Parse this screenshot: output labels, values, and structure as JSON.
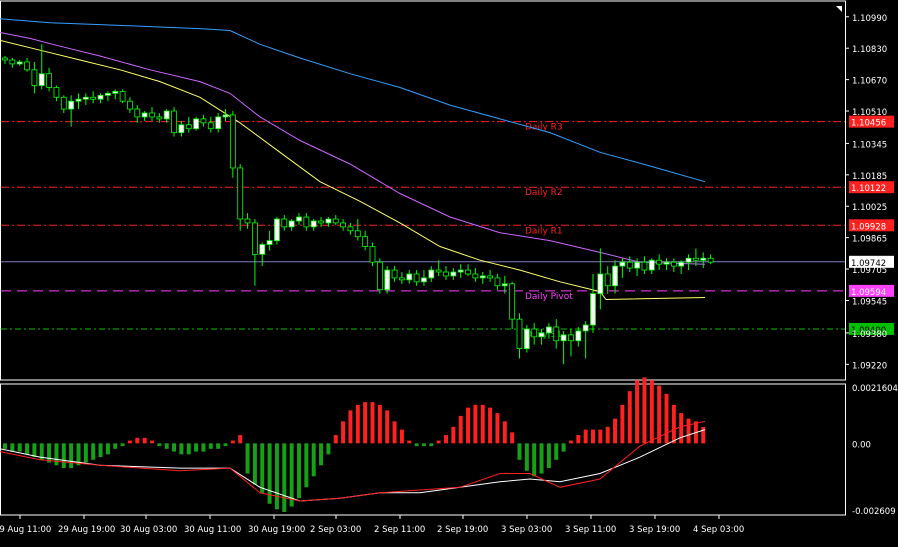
{
  "colors": {
    "background": "#000000",
    "frame": "#ffffff",
    "bull_candle": "#ffffff",
    "bear_candle": "#000000",
    "candle_outline": "#00ff00",
    "ma_fast": "#ffff66",
    "ma_mid": "#cc66ff",
    "ma_slow": "#33a0ff",
    "pivot_red": "#ff2020",
    "pivot_magenta": "#ff40ff",
    "pivot_green": "#00c000",
    "price_line": "#8080c0",
    "hist_pos": "#ff2020",
    "hist_neg": "#16a016",
    "macd_line": "#ffffff",
    "signal_line": "#ff2020"
  },
  "chart_data": [
    {
      "type": "candlestick",
      "title": "",
      "ylim": [
        1.0914,
        1.1105
      ],
      "y_ticks": [
        "1.10990",
        "1.10830",
        "1.10670",
        "1.10510",
        "1.10345",
        "1.10185",
        "1.10025",
        "1.09865",
        "1.09705",
        "1.09545",
        "1.09380",
        "1.09220"
      ],
      "x_ticks": [
        "29 Aug 11:00",
        "29 Aug 19:00",
        "30 Aug 03:00",
        "30 Aug 11:00",
        "30 Aug 19:00",
        "2 Sep 03:00",
        "2 Sep 11:00",
        "2 Sep 19:00",
        "3 Sep 03:00",
        "3 Sep 11:00",
        "3 Sep 19:00",
        "4 Sep 03:00"
      ],
      "pivots": [
        {
          "label": "Daily R3",
          "value": 1.10456,
          "price_label": "1.10456",
          "color": "red"
        },
        {
          "label": "Daily R2",
          "value": 1.10122,
          "price_label": "1.10122",
          "color": "red"
        },
        {
          "label": "Daily R1",
          "value": 1.09928,
          "price_label": "1.09928",
          "color": "red"
        },
        {
          "label": "Daily Pivot",
          "value": 1.09594,
          "price_label": "1.09594",
          "color": "magenta"
        },
        {
          "label": "Daily S1",
          "value": 1.094,
          "price_label": "1.09400",
          "color": "green"
        }
      ],
      "current_price": 1.09742,
      "current_price_label": "1.09742",
      "series": [
        {
          "name": "",
          "role": "ma_slow",
          "color": "#33a0ff",
          "points": [
            [
              0,
              1.1098
            ],
            [
              50,
              1.1096
            ],
            [
              100,
              1.1095
            ],
            [
              150,
              1.1094
            ],
            [
              200,
              1.1093
            ],
            [
              230,
              1.1092
            ],
            [
              260,
              1.1085
            ],
            [
              300,
              1.1078
            ],
            [
              350,
              1.107
            ],
            [
              400,
              1.1063
            ],
            [
              450,
              1.1054
            ],
            [
              500,
              1.1047
            ],
            [
              550,
              1.104
            ],
            [
              600,
              1.103
            ],
            [
              650,
              1.1023
            ],
            [
              705,
              1.1015
            ]
          ]
        },
        {
          "name": "",
          "role": "ma_mid",
          "color": "#cc66ff",
          "points": [
            [
              0,
              1.1091
            ],
            [
              30,
              1.1088
            ],
            [
              60,
              1.1084
            ],
            [
              100,
              1.1079
            ],
            [
              150,
              1.1072
            ],
            [
              200,
              1.1066
            ],
            [
              230,
              1.106
            ],
            [
              260,
              1.1048
            ],
            [
              300,
              1.1036
            ],
            [
              350,
              1.1024
            ],
            [
              400,
              1.1009
            ],
            [
              450,
              1.0997
            ],
            [
              500,
              1.0989
            ],
            [
              550,
              1.0985
            ],
            [
              600,
              1.0979
            ],
            [
              640,
              1.0974
            ],
            [
              705,
              1.0973
            ]
          ]
        },
        {
          "name": "",
          "role": "ma_fast",
          "color": "#ffff66",
          "points": [
            [
              0,
              1.1087
            ],
            [
              40,
              1.1082
            ],
            [
              80,
              1.1077
            ],
            [
              120,
              1.1072
            ],
            [
              160,
              1.1066
            ],
            [
              200,
              1.1058
            ],
            [
              240,
              1.1045
            ],
            [
              280,
              1.103
            ],
            [
              320,
              1.1015
            ],
            [
              360,
              1.1005
            ],
            [
              400,
              1.0994
            ],
            [
              440,
              1.0982
            ],
            [
              480,
              1.0975
            ],
            [
              520,
              1.097
            ],
            [
              560,
              1.0964
            ],
            [
              600,
              1.0959
            ],
            [
              606,
              1.0955
            ],
            [
              705,
              1.0956
            ]
          ]
        }
      ],
      "candles": [
        [
          1.1078,
          1.1079,
          1.1075,
          1.1077
        ],
        [
          1.1077,
          1.1078,
          1.1073,
          1.1075
        ],
        [
          1.1075,
          1.1077,
          1.1074,
          1.1076
        ],
        [
          1.1076,
          1.1078,
          1.1071,
          1.1072
        ],
        [
          1.1072,
          1.1076,
          1.106,
          1.1064
        ],
        [
          1.1064,
          1.1085,
          1.1062,
          1.107
        ],
        [
          1.107,
          1.1073,
          1.1061,
          1.1063
        ],
        [
          1.1063,
          1.1064,
          1.1056,
          1.1058
        ],
        [
          1.1058,
          1.1059,
          1.105,
          1.1052
        ],
        [
          1.1052,
          1.1059,
          1.1043,
          1.1056
        ],
        [
          1.1056,
          1.106,
          1.1052,
          1.1057
        ],
        [
          1.1057,
          1.106,
          1.1054,
          1.1058
        ],
        [
          1.1058,
          1.1061,
          1.1055,
          1.1057
        ],
        [
          1.1057,
          1.106,
          1.1055,
          1.1059
        ],
        [
          1.1059,
          1.1061,
          1.1056,
          1.106
        ],
        [
          1.106,
          1.1062,
          1.1057,
          1.1061
        ],
        [
          1.1061,
          1.1062,
          1.1055,
          1.1056
        ],
        [
          1.1056,
          1.1058,
          1.105,
          1.1052
        ],
        [
          1.1052,
          1.1054,
          1.1045,
          1.1048
        ],
        [
          1.1048,
          1.1051,
          1.1046,
          1.105
        ],
        [
          1.105,
          1.1053,
          1.1046,
          1.1048
        ],
        [
          1.1048,
          1.105,
          1.1045,
          1.1047
        ],
        [
          1.1047,
          1.1052,
          1.1045,
          1.1051
        ],
        [
          1.1051,
          1.1053,
          1.1038,
          1.104
        ],
        [
          1.104,
          1.1046,
          1.1038,
          1.1044
        ],
        [
          1.1044,
          1.1048,
          1.104,
          1.1042
        ],
        [
          1.1042,
          1.1048,
          1.1041,
          1.1047
        ],
        [
          1.1047,
          1.1049,
          1.1043,
          1.1045
        ],
        [
          1.1045,
          1.1048,
          1.104,
          1.1042
        ],
        [
          1.1042,
          1.105,
          1.104,
          1.1048
        ],
        [
          1.1048,
          1.1052,
          1.1046,
          1.1049
        ],
        [
          1.1049,
          1.1051,
          1.1017,
          1.1022
        ],
        [
          1.1022,
          1.1024,
          1.099,
          1.0996
        ],
        [
          1.0996,
          1.0999,
          1.0991,
          1.0994
        ],
        [
          1.0994,
          1.0996,
          1.0962,
          1.0978
        ],
        [
          1.0978,
          1.0984,
          1.0972,
          1.0983
        ],
        [
          1.0983,
          1.099,
          1.098,
          1.0985
        ],
        [
          1.0985,
          1.0997,
          1.0983,
          1.0996
        ],
        [
          1.0996,
          1.0998,
          1.099,
          1.0992
        ],
        [
          1.0992,
          1.0996,
          1.099,
          1.0995
        ],
        [
          1.0995,
          1.0999,
          1.0993,
          1.0997
        ],
        [
          1.0997,
          1.0999,
          1.099,
          1.0992
        ],
        [
          1.0992,
          1.0996,
          1.099,
          1.0995
        ],
        [
          1.0995,
          1.0997,
          1.0992,
          1.0994
        ],
        [
          1.0994,
          1.0997,
          1.0992,
          1.0996
        ],
        [
          1.0996,
          1.0998,
          1.0993,
          1.0994
        ],
        [
          1.0994,
          1.0996,
          1.099,
          1.0992
        ],
        [
          1.0992,
          1.0994,
          1.0988,
          1.099
        ],
        [
          1.099,
          1.0996,
          1.0985,
          1.0987
        ],
        [
          1.0987,
          1.099,
          1.098,
          1.0982
        ],
        [
          1.0982,
          1.0984,
          1.0972,
          1.0974
        ],
        [
          1.0974,
          1.0976,
          1.0958,
          1.096
        ],
        [
          1.096,
          1.0972,
          1.0958,
          1.097
        ],
        [
          1.097,
          1.0972,
          1.0964,
          1.0966
        ],
        [
          1.0966,
          1.0969,
          1.0963,
          1.0965
        ],
        [
          1.0965,
          1.097,
          1.0963,
          1.0968
        ],
        [
          1.0968,
          1.097,
          1.0962,
          1.0964
        ],
        [
          1.0964,
          1.097,
          1.0962,
          1.0966
        ],
        [
          1.0966,
          1.0972,
          1.0964,
          1.097
        ],
        [
          1.097,
          1.0975,
          1.0967,
          1.0969
        ],
        [
          1.0969,
          1.0972,
          1.0965,
          1.0967
        ],
        [
          1.0967,
          1.0971,
          1.0965,
          1.0969
        ],
        [
          1.0969,
          1.0973,
          1.0966,
          1.097
        ],
        [
          1.097,
          1.0973,
          1.0967,
          1.0968
        ],
        [
          1.0968,
          1.0971,
          1.0964,
          1.0966
        ],
        [
          1.0966,
          1.0969,
          1.0963,
          1.0967
        ],
        [
          1.0967,
          1.097,
          1.0964,
          1.0966
        ],
        [
          1.0966,
          1.0968,
          1.096,
          1.0962
        ],
        [
          1.0962,
          1.0967,
          1.0958,
          1.0963
        ],
        [
          1.0963,
          1.0964,
          1.094,
          1.0945
        ],
        [
          1.0945,
          1.0948,
          1.0925,
          1.093
        ],
        [
          1.093,
          1.0942,
          1.0928,
          1.094
        ],
        [
          1.094,
          1.0943,
          1.0932,
          1.0936
        ],
        [
          1.0936,
          1.094,
          1.0932,
          1.0938
        ],
        [
          1.0938,
          1.0943,
          1.0935,
          1.0941
        ],
        [
          1.0941,
          1.0945,
          1.093,
          1.0934
        ],
        [
          1.0934,
          1.0939,
          1.0922,
          1.0937
        ],
        [
          1.0937,
          1.094,
          1.0926,
          1.0934
        ],
        [
          1.0934,
          1.0941,
          1.0931,
          1.0939
        ],
        [
          1.0939,
          1.0944,
          1.0925,
          1.0942
        ],
        [
          1.0942,
          1.0968,
          1.0938,
          1.0958
        ],
        [
          1.0958,
          1.0981,
          1.095,
          1.0968
        ],
        [
          1.0968,
          1.0972,
          1.0958,
          1.0962
        ],
        [
          1.0962,
          1.0975,
          1.0958,
          1.0972
        ],
        [
          1.0972,
          1.0976,
          1.0966,
          1.0974
        ],
        [
          1.0974,
          1.0977,
          1.0969,
          1.0971
        ],
        [
          1.0971,
          1.0976,
          1.0967,
          1.0974
        ],
        [
          1.0974,
          1.0977,
          1.0968,
          1.097
        ],
        [
          1.097,
          1.0976,
          1.0968,
          1.0975
        ],
        [
          1.0975,
          1.0978,
          1.097,
          1.0973
        ],
        [
          1.0973,
          1.0976,
          1.097,
          1.0974
        ],
        [
          1.0974,
          1.0976,
          1.0969,
          1.0972
        ],
        [
          1.0972,
          1.0975,
          1.0968,
          1.0974
        ],
        [
          1.0974,
          1.0978,
          1.097,
          1.0976
        ],
        [
          1.0976,
          1.0981,
          1.0972,
          1.0975
        ],
        [
          1.0975,
          1.0979,
          1.0971,
          1.0976
        ],
        [
          1.0976,
          1.0978,
          1.0973,
          1.0974
        ]
      ]
    },
    {
      "type": "bar",
      "title": "",
      "ylim": [
        -0.002609,
        0.00216
      ],
      "y_ticks": [
        "0.0021604",
        "0.00",
        "-0.002609"
      ],
      "histogram": [
        -0.0002,
        -0.0003,
        -0.0003,
        -0.0004,
        -0.0005,
        -0.0006,
        -0.0007,
        -0.0008,
        -0.0009,
        -0.0009,
        -0.0008,
        -0.0007,
        -0.0006,
        -0.0005,
        -0.0004,
        -0.0002,
        -0.0001,
        0.0001,
        0.0002,
        0.0002,
        0.0001,
        -0.0001,
        -0.0002,
        -0.0003,
        -0.0004,
        -0.0004,
        -0.0003,
        -0.0003,
        -0.0002,
        -0.0002,
        -0.0001,
        0.0001,
        0.0003,
        -0.0011,
        -0.0015,
        -0.0018,
        -0.0022,
        -0.0024,
        -0.0025,
        -0.0023,
        -0.002,
        -0.0016,
        -0.0012,
        -0.0008,
        -0.0004,
        0.0003,
        0.0008,
        0.0012,
        0.0014,
        0.0015,
        0.0015,
        0.0014,
        0.0012,
        0.0008,
        0.0005,
        0.0001,
        -0.0001,
        -0.0001,
        -0.0001,
        0.0001,
        0.0003,
        0.0006,
        0.001,
        0.0013,
        0.0014,
        0.0014,
        0.0013,
        0.0011,
        0.0008,
        0.0004,
        -0.0006,
        -0.001,
        -0.0012,
        -0.0011,
        -0.0009,
        -0.0006,
        -0.0003,
        0.0001,
        0.0003,
        0.0005,
        0.0005,
        0.0005,
        0.0006,
        0.0009,
        0.0014,
        0.0019,
        0.0023,
        0.0024,
        0.0023,
        0.0021,
        0.0018,
        0.0014,
        0.0011,
        0.0009,
        0.0008,
        0.0006
      ],
      "series": [
        {
          "name": "",
          "role": "macd",
          "color": "#ffffff",
          "points": [
            [
              0,
              -0.0002
            ],
            [
              40,
              -0.0005
            ],
            [
              100,
              -0.0008
            ],
            [
              180,
              -0.0009
            ],
            [
              230,
              -0.0009
            ],
            [
              260,
              -0.0016
            ],
            [
              300,
              -0.0021
            ],
            [
              340,
              -0.002
            ],
            [
              380,
              -0.0018
            ],
            [
              420,
              -0.0018
            ],
            [
              460,
              -0.0016
            ],
            [
              500,
              -0.0014
            ],
            [
              530,
              -0.0013
            ],
            [
              560,
              -0.0014
            ],
            [
              600,
              -0.0011
            ],
            [
              640,
              -0.0005
            ],
            [
              680,
              0.0002
            ],
            [
              705,
              0.0005
            ]
          ]
        },
        {
          "name": "",
          "role": "signal",
          "color": "#ff2020",
          "points": [
            [
              0,
              -0.0003
            ],
            [
              40,
              -0.0006
            ],
            [
              100,
              -0.0008
            ],
            [
              180,
              -0.001
            ],
            [
              230,
              -0.0009
            ],
            [
              260,
              -0.0018
            ],
            [
              300,
              -0.0021
            ],
            [
              340,
              -0.002
            ],
            [
              380,
              -0.0018
            ],
            [
              420,
              -0.0017
            ],
            [
              460,
              -0.0016
            ],
            [
              500,
              -0.0011
            ],
            [
              530,
              -0.0011
            ],
            [
              560,
              -0.0016
            ],
            [
              600,
              -0.0013
            ],
            [
              640,
              -0.0001
            ],
            [
              680,
              0.0006
            ],
            [
              705,
              0.0008
            ]
          ]
        }
      ]
    }
  ]
}
